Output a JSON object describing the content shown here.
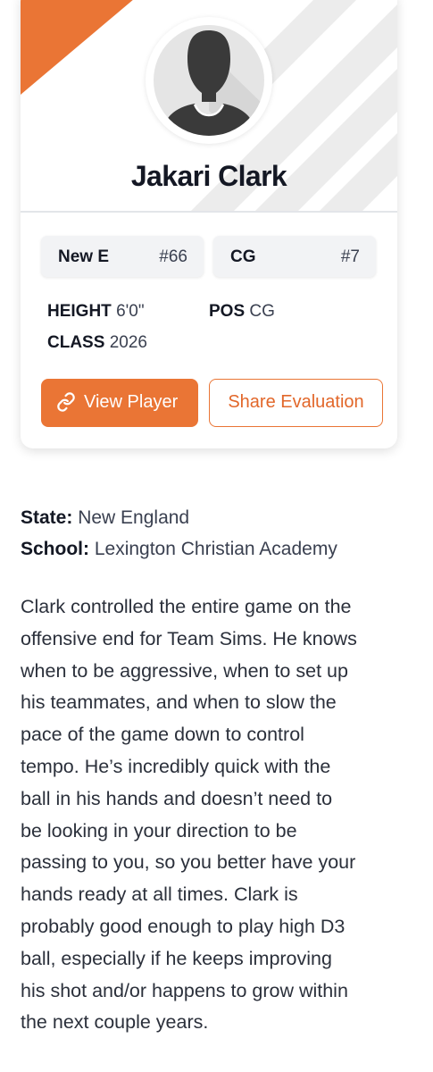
{
  "player": {
    "name": "Jakari Clark",
    "team_chip": {
      "team": "New E",
      "number": "#66"
    },
    "position_chip": {
      "position": "CG",
      "number": "#7"
    },
    "stats": {
      "height_label": "HEIGHT",
      "height_value": "6'0\"",
      "pos_label": "POS",
      "pos_value": "CG",
      "class_label": "CLASS",
      "class_value": "2026"
    }
  },
  "actions": {
    "view_player": "View Player",
    "share_evaluation": "Share Evaluation"
  },
  "info": {
    "state_label": "State:",
    "state_value": "New England",
    "school_label": "School:",
    "school_value": "Lexington Christian Academy"
  },
  "evaluation": {
    "lines": [
      "Clark controlled the entire game on the",
      "offensive end for Team Sims. He knows",
      "when to be aggressive, when to set up",
      "his teammates, and when to slow the",
      "pace of the game down to control",
      "tempo. He’s incredibly quick with the",
      "ball in his hands and doesn’t need to",
      "be looking in your direction to be",
      "passing to you, so you better have your",
      "hands ready at all times. Clark is",
      "probably good enough to play high D3",
      "ball, especially if he keeps improving",
      "his shot and/or happens to grow within",
      "the next couple years."
    ]
  },
  "colors": {
    "accent": "#ea7535",
    "stripe": "#ececec",
    "chip_bg": "#f2f3f5",
    "avatar_bg": "#e5e5e5",
    "silhouette": "#3a3a3a"
  },
  "icons": {
    "avatar": "person-silhouette-icon",
    "view_player": "link-icon"
  }
}
